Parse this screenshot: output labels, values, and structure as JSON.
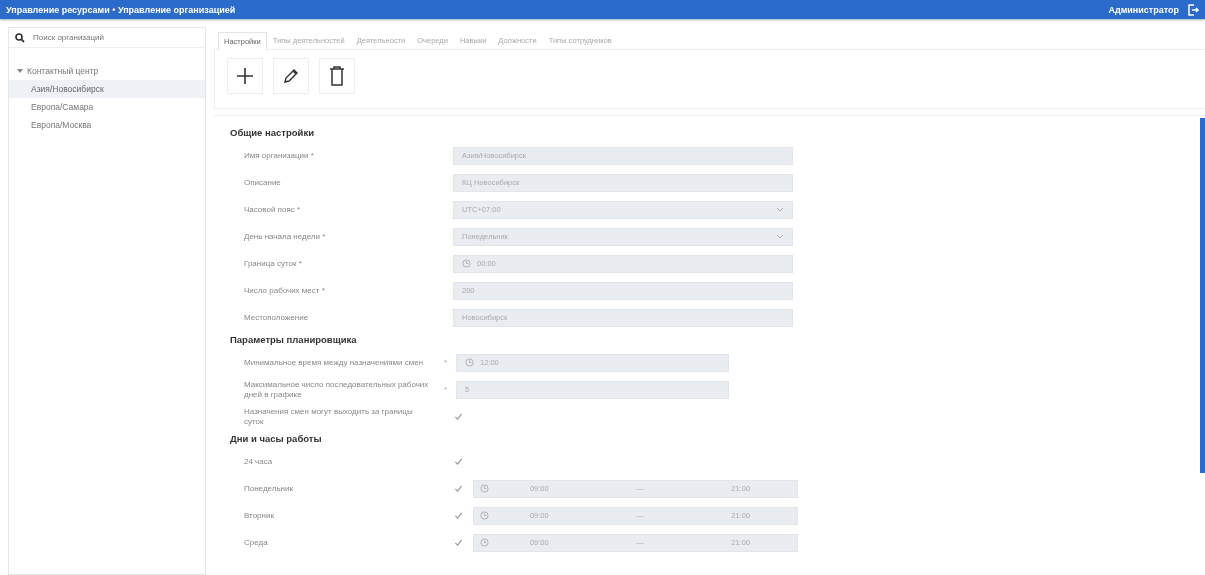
{
  "header": {
    "title": "Управление ресурсами • Управление организацией",
    "user": "Администратор"
  },
  "sidebar": {
    "search": {
      "placeholder": "Поиск организаций"
    },
    "tree": [
      {
        "label": "Контактный центр",
        "expanded": true,
        "selected": false,
        "children": [
          {
            "label": "Азия/Новосибирск",
            "selected": true
          },
          {
            "label": "Европа/Самара",
            "selected": false
          },
          {
            "label": "Европа/Москва",
            "selected": false
          }
        ]
      }
    ]
  },
  "tabs": [
    {
      "label": "Настройки",
      "selected": true
    },
    {
      "label": "Типы деятельностей",
      "selected": false
    },
    {
      "label": "Деятельности",
      "selected": false
    },
    {
      "label": "Очереди",
      "selected": false
    },
    {
      "label": "Навыки",
      "selected": false
    },
    {
      "label": "Должности",
      "selected": false
    },
    {
      "label": "Типы сотрудников",
      "selected": false
    }
  ],
  "sections": [
    {
      "title": "Общие настройки",
      "fields": [
        {
          "kind": "text",
          "label": "Имя организации *",
          "value": "Азия/Новосибирск"
        },
        {
          "kind": "text",
          "label": "Описание",
          "value": "КЦ Новосибирск"
        },
        {
          "kind": "select",
          "label": "Часовой пояс *",
          "value": "UTC+07:00"
        },
        {
          "kind": "select",
          "label": "День начала недели *",
          "value": "Понедельник"
        },
        {
          "kind": "time",
          "label": "Граница суток *",
          "value": "00:00"
        },
        {
          "kind": "text",
          "label": "Число рабочих мест *",
          "value": "200"
        },
        {
          "kind": "text",
          "label": "Местоположение",
          "value": "Новосибирск"
        }
      ]
    },
    {
      "title": "Параметры планировщика",
      "fields": [
        {
          "kind": "time",
          "label": "Минимальное время между назначениями смен",
          "mark": "*",
          "value": "12:00"
        },
        {
          "kind": "text",
          "label": "Максимальное число последовательных рабочих дней в графике",
          "mark": "*",
          "value": "5"
        },
        {
          "kind": "checkbox",
          "label": "Назначения смен могут выходить за границы суток",
          "checked": true
        }
      ]
    },
    {
      "title": "Дни и часы работы",
      "fields": [
        {
          "kind": "checkbox",
          "label": "24 часа",
          "checked": true
        },
        {
          "kind": "hours",
          "label": "Понедельник",
          "checked": true,
          "from": "09:00",
          "separator": "—",
          "to": "21:00"
        },
        {
          "kind": "hours",
          "label": "Вторник",
          "checked": true,
          "from": "09:00",
          "separator": "—",
          "to": "21:00"
        },
        {
          "kind": "hours",
          "label": "Среда",
          "checked": true,
          "from": "09:00",
          "separator": "—",
          "to": "21:00"
        }
      ]
    }
  ]
}
